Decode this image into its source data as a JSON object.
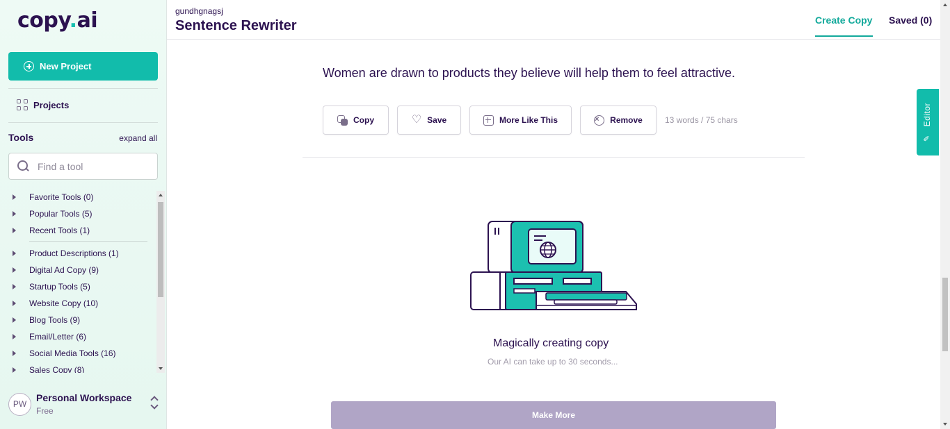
{
  "brand": {
    "logo_text_1": "copy",
    "logo_dot": ".",
    "logo_text_2": "ai",
    "accent_color": "#12bcab",
    "primary_text_color": "#2c1250"
  },
  "sidebar": {
    "new_project_label": "New Project",
    "projects_label": "Projects",
    "tools_title": "Tools",
    "expand_all_label": "expand all",
    "search_placeholder": "Find a tool",
    "tool_groups": [
      {
        "label": "Favorite Tools (0)"
      },
      {
        "label": "Popular Tools (5)"
      },
      {
        "label": "Recent Tools (1)"
      },
      {
        "label": "Product Descriptions (1)"
      },
      {
        "label": "Digital Ad Copy (9)"
      },
      {
        "label": "Startup Tools (5)"
      },
      {
        "label": "Website Copy (10)"
      },
      {
        "label": "Blog Tools (9)"
      },
      {
        "label": "Email/Letter (6)"
      },
      {
        "label": "Social Media Tools (16)"
      },
      {
        "label": "Sales Copy (8)"
      }
    ],
    "workspace": {
      "initials": "PW",
      "name": "Personal Workspace",
      "plan": "Free"
    }
  },
  "header": {
    "breadcrumb": "gundhgnagsj",
    "title": "Sentence Rewriter",
    "tabs": [
      {
        "label": "Create Copy",
        "active": true
      },
      {
        "label": "Saved (0)",
        "active": false
      }
    ]
  },
  "main": {
    "result_text": "Women are drawn to products they believe will help them to feel attractive.",
    "actions": {
      "copy": "Copy",
      "save": "Save",
      "more_like_this": "More Like This",
      "remove": "Remove"
    },
    "count_text": "13 words / 75 chars",
    "loading_title": "Magically creating copy",
    "loading_subtitle": "Our AI can take up to 30 seconds...",
    "make_more_label": "Make More"
  },
  "editor_tab_label": "Editor"
}
